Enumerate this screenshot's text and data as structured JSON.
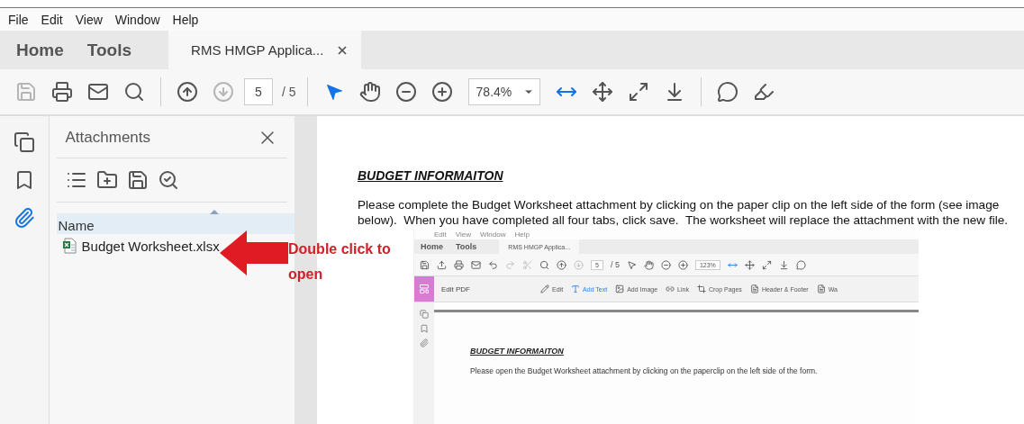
{
  "menu": [
    "File",
    "Edit",
    "View",
    "Window",
    "Help"
  ],
  "tabs": [
    {
      "label": "Home",
      "selected": false,
      "closable": false
    },
    {
      "label": "Tools",
      "selected": false,
      "closable": false
    },
    {
      "label": "RMS HMGP Applica...",
      "selected": true,
      "closable": true
    }
  ],
  "toolbar": [
    [
      {
        "kind": "button",
        "disabled": true,
        "selected": false
      },
      {
        "kind": "button",
        "disabled": false,
        "selected": false
      },
      {
        "kind": "button",
        "disabled": false,
        "selected": false
      },
      {
        "kind": "button",
        "disabled": false,
        "selected": false
      }
    ],
    [
      {
        "kind": "button",
        "disabled": false,
        "selected": false
      },
      {
        "kind": "button",
        "disabled": true,
        "selected": false
      },
      {
        "kind": "page",
        "value": "5",
        "total": "/ 5"
      }
    ],
    [
      {
        "kind": "button",
        "disabled": false,
        "selected": true
      },
      {
        "kind": "button",
        "disabled": false,
        "selected": false
      },
      {
        "kind": "button",
        "disabled": false,
        "selected": false
      },
      {
        "kind": "button",
        "disabled": false,
        "selected": false
      },
      {
        "kind": "zoom",
        "value": "78.4%"
      },
      {
        "kind": "button",
        "disabled": false,
        "selected": true
      },
      {
        "kind": "button",
        "disabled": false,
        "selected": false
      },
      {
        "kind": "button",
        "disabled": false,
        "selected": false
      },
      {
        "kind": "button",
        "disabled": false,
        "selected": false
      }
    ],
    [
      {
        "kind": "button",
        "disabled": false,
        "selected": false
      },
      {
        "kind": "button",
        "disabled": false,
        "selected": false
      }
    ]
  ],
  "rail": [
    {
      "selected": false
    },
    {
      "selected": false
    },
    {
      "selected": true
    }
  ],
  "attachments": {
    "title": "Attachments",
    "column": "Name",
    "files": [
      {
        "name": "Budget Worksheet.xlsx"
      }
    ]
  },
  "document": {
    "heading": "BUDGET INFORMAITON",
    "paragraph": "Please complete the Budget Worksheet attachment by clicking on the paper clip on the left side of the form (see image below).  When you have completed all four tabs, click save.  The worksheet will replace the attachment with the new file."
  },
  "annotation": {
    "text": "Double click to open"
  },
  "embedded_screenshot": {
    "menu": [
      "Edit",
      "View",
      "Window",
      "Help"
    ],
    "tabs": [
      {
        "label": "Home",
        "selected": false
      },
      {
        "label": "Tools",
        "selected": false
      },
      {
        "label": "RMS HMGP Applica...",
        "selected": true
      }
    ],
    "page": "5",
    "page_total": "/ 5",
    "zoom": "123%",
    "edit_label": "Edit PDF",
    "edit_tools": [
      {
        "label": "Edit",
        "selected": false
      },
      {
        "label": "Add Text",
        "selected": true
      },
      {
        "label": "Add Image",
        "selected": false
      },
      {
        "label": "Link",
        "selected": false
      },
      {
        "label": "Crop Pages",
        "selected": false
      },
      {
        "label": "Header & Footer",
        "selected": false
      },
      {
        "label": "Wa",
        "selected": false
      }
    ],
    "heading": "BUDGET INFORMAITON",
    "paragraph": "Please open the Budget Worksheet attachment by clicking on the paperclip on the left side of the form."
  }
}
